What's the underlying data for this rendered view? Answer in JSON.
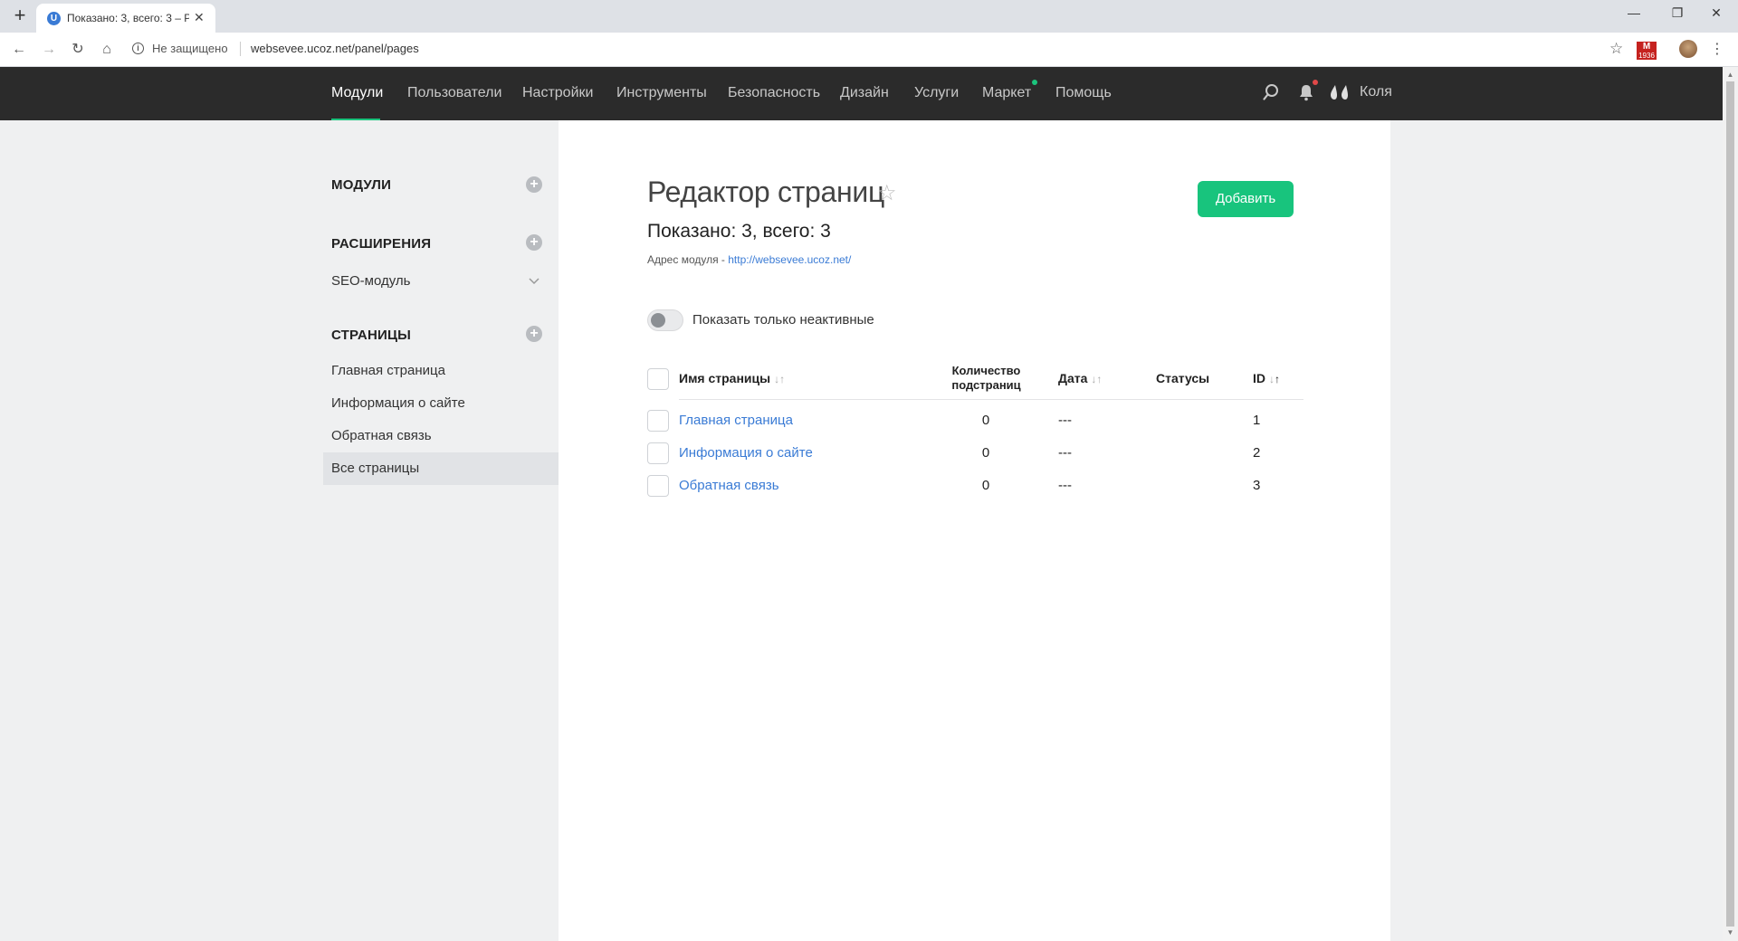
{
  "browser": {
    "tab_title": "Показано: 3, всего: 3 – P",
    "tab_favicon": "U",
    "security_label": "Не защищено",
    "url": "websevee.ucoz.net/panel/pages",
    "gmail_badge": "M",
    "gmail_count": "1936"
  },
  "topnav": {
    "items": [
      "Модули",
      "Пользователи",
      "Настройки",
      "Инструменты",
      "Безопасность",
      "Дизайн",
      "Услуги",
      "Маркет",
      "Помощь"
    ],
    "username": "Коля"
  },
  "sidebar": {
    "modules_heading": "МОДУЛИ",
    "extensions_heading": "РАСШИРЕНИЯ",
    "seo_item": "SEO-модуль",
    "pages_heading": "СТРАНИЦЫ",
    "pages": [
      "Главная страница",
      "Информация о сайте",
      "Обратная связь",
      "Все страницы"
    ]
  },
  "main": {
    "title": "Редактор страниц",
    "add_button": "Добавить",
    "shown_count": "Показано: 3, всего: 3",
    "module_address_label": "Адрес модуля - ",
    "module_address_url": "http://websevee.ucoz.net/",
    "toggle_label": "Показать только неактивные",
    "table": {
      "headers": {
        "name": "Имя страницы",
        "subpages": "Количество подстраниц",
        "date": "Дата",
        "statuses": "Статусы",
        "id": "ID"
      },
      "rows": [
        {
          "name": "Главная страница",
          "subpages": "0",
          "date": "---",
          "id": "1"
        },
        {
          "name": "Информация о сайте",
          "subpages": "0",
          "date": "---",
          "id": "2"
        },
        {
          "name": "Обратная связь",
          "subpages": "0",
          "date": "---",
          "id": "3"
        }
      ]
    }
  },
  "colors": {
    "accent": "#18c47d",
    "topnav_bg": "#2b2b2b",
    "link": "#3a7bd5",
    "sidebar_bg": "#eff0f1"
  }
}
